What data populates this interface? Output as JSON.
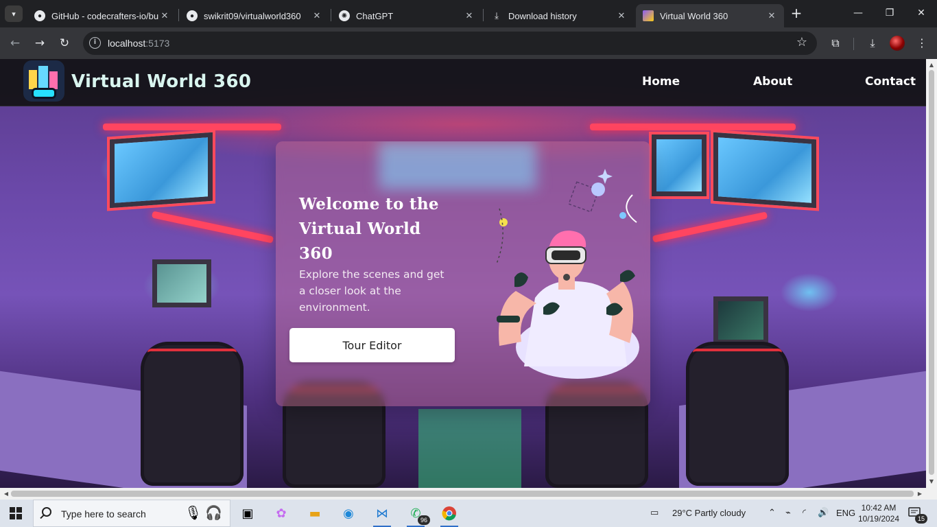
{
  "browser": {
    "tabs": [
      {
        "title": "GitHub - codecrafters-io/build-your-own-x",
        "icon": "github-icon"
      },
      {
        "title": "swikrit09/virtualworld360",
        "icon": "github-icon"
      },
      {
        "title": "ChatGPT",
        "icon": "chatgpt-icon"
      },
      {
        "title": "Download history",
        "icon": "download-icon"
      },
      {
        "title": "Virtual World 360",
        "icon": "vite-icon",
        "active": true
      }
    ],
    "address": {
      "host": "localhost",
      "port": ":5173"
    }
  },
  "site": {
    "title": "Virtual World 360",
    "nav": [
      "Home",
      "About",
      "Contact"
    ]
  },
  "hero": {
    "title": "Welcome to the Virtual World 360",
    "subtitle": "Explore the scenes and get a closer look at the environment.",
    "button": "Tour Editor"
  },
  "taskbar": {
    "search_placeholder": "Type here to search",
    "whatsapp_badge": "96",
    "weather": "29°C  Partly cloudy",
    "language": "ENG",
    "time": "10:42 AM",
    "date": "10/19/2024",
    "notifications": "15"
  },
  "colors": {
    "accent": "#2f6fc9",
    "site_title": "#d9f5ef",
    "neon_red": "#ff4560"
  }
}
